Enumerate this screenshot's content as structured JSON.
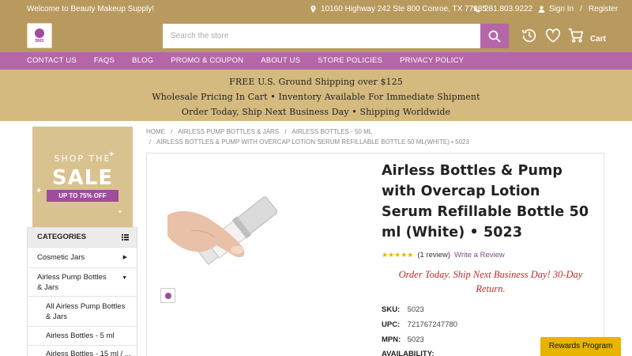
{
  "topbar": {
    "welcome": "Welcome to Beauty Makeup Supply!",
    "address": "10160 Highway 242 Ste 800 Conroe, TX 77385",
    "phone": "281.803.9222",
    "sign_in": "Sign In",
    "separator": "/",
    "register": "Register"
  },
  "header": {
    "logo_text": "BMS",
    "search_placeholder": "Search the store",
    "cart_label": "Cart"
  },
  "nav": {
    "items": [
      "CONTACT US",
      "FAQS",
      "BLOG",
      "PROMO & COUPON",
      "ABOUT US",
      "STORE POLICIES",
      "PRIVACY POLICY"
    ]
  },
  "banner": {
    "line1": "FREE U.S. Ground Shipping over $125",
    "line2": "Wholesale Pricing In Cart • Inventory Available For Immediate Shipment",
    "line3": "Order Today, Ship Next Business Day • Shipping Worldwide"
  },
  "promo": {
    "shop_the": "SHOP THE",
    "sale": "SALE",
    "up_to": "UP TO 75% OFF"
  },
  "categories": {
    "title": "CATEGORIES",
    "items": [
      "Cosmetic Jars",
      "Airless Pump Bottles & Jars",
      "All Airless Pump Bottles & Jars",
      "Airless Bottles - 5 ml",
      "Airless Bottles - 15 ml / ..."
    ]
  },
  "breadcrumb": {
    "items": [
      "HOME",
      "AIRLESS PUMP BOTTLES & JARS",
      "AIRLESS BOTTLES - 50 ML",
      "AIRLESS BOTTLES & PUMP WITH OVERCAP LOTION SERUM REFILLABLE BOTTLE 50 ML(WHITE) • 5023"
    ],
    "separator": "/"
  },
  "product": {
    "title": "Airless Bottles & Pump with Overcap Lotion Serum Refillable Bottle 50 ml (White) • 5023",
    "rating": 5,
    "stars": "★★★★★",
    "review_count": "(1 review)",
    "write_review": "Write a Review",
    "order_note": "Order Today. Ship Next Business Day! 30-Day Return.",
    "specs": {
      "sku_label": "SKU:",
      "sku": "5023",
      "upc_label": "UPC:",
      "upc": "721767247780",
      "mpn_label": "MPN:",
      "mpn": "5023",
      "availability_label": "AVAILABILITY:"
    }
  },
  "rewards": {
    "label": "Rewards Program"
  },
  "colors": {
    "gold": "#b89a5e",
    "banner_gold": "#d4ba7f",
    "purple": "#b566a8",
    "note_red": "#c22a2a",
    "star": "#e6b300",
    "rewards": "#e8b400"
  }
}
